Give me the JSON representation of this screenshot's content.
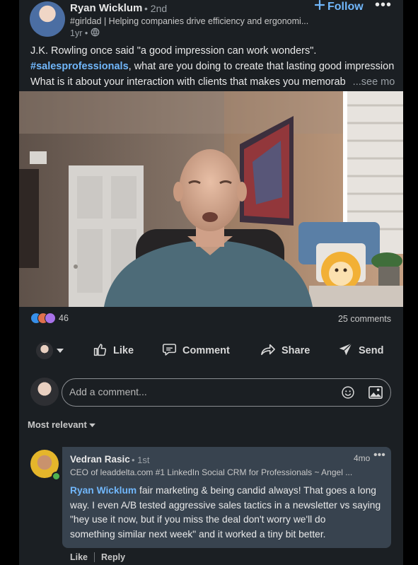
{
  "post": {
    "author": {
      "name": "Ryan Wicklum",
      "degree": "• 2nd",
      "headline": "#girldad | Helping companies drive efficiency and ergonomi...",
      "time": "1yr •"
    },
    "follow_label": "Follow",
    "more_label": "•••",
    "text": {
      "line1": "J.K. Rowling once said \"a good impression can work wonders\".",
      "hashtag": "#salesprofessionals",
      "line2_rest": ", what are you doing to create that lasting good impression?",
      "line3": "What is it about your interaction with clients that makes you memorab",
      "see_more": "...see more"
    },
    "reaction_count": "46",
    "comments_count": "25 comments",
    "actions": {
      "like": "Like",
      "comment": "Comment",
      "share": "Share",
      "send": "Send"
    }
  },
  "comment_input": {
    "placeholder": "Add a comment..."
  },
  "sort_label": "Most relevant",
  "comments": [
    {
      "name": "Vedran Rasic",
      "degree": "• 1st",
      "headline": "CEO of leaddelta.com #1 LinkedIn Social CRM for Professionals ~ Angel ...",
      "time": "4mo",
      "more": "•••",
      "mention": "Ryan Wicklum",
      "text_line1": " fair marketing & being candid always! That goes a long",
      "text_line2": "way. I even A/B tested aggressive sales tactics in a newsletter vs saying",
      "text_line3": "\"hey use it now, but if you miss the deal don't worry we'll do",
      "text_line4": "something similar next week\" and it worked a tiny bit better.",
      "like_label": "Like",
      "reply_label": "Reply"
    }
  ],
  "colors": {
    "background": "#1b1f23",
    "link": "#71b7fb",
    "comment_bubble": "#38434f",
    "online": "#4fb34f"
  },
  "icons": {
    "follow": "plus-icon",
    "visibility": "globe-icon",
    "like": "thumbs-up-icon",
    "comment": "speech-bubble-icon",
    "share": "share-arrow-icon",
    "send": "paper-plane-icon",
    "emoji": "smiley-icon",
    "photo": "image-icon",
    "dropdown": "caret-down-icon"
  }
}
